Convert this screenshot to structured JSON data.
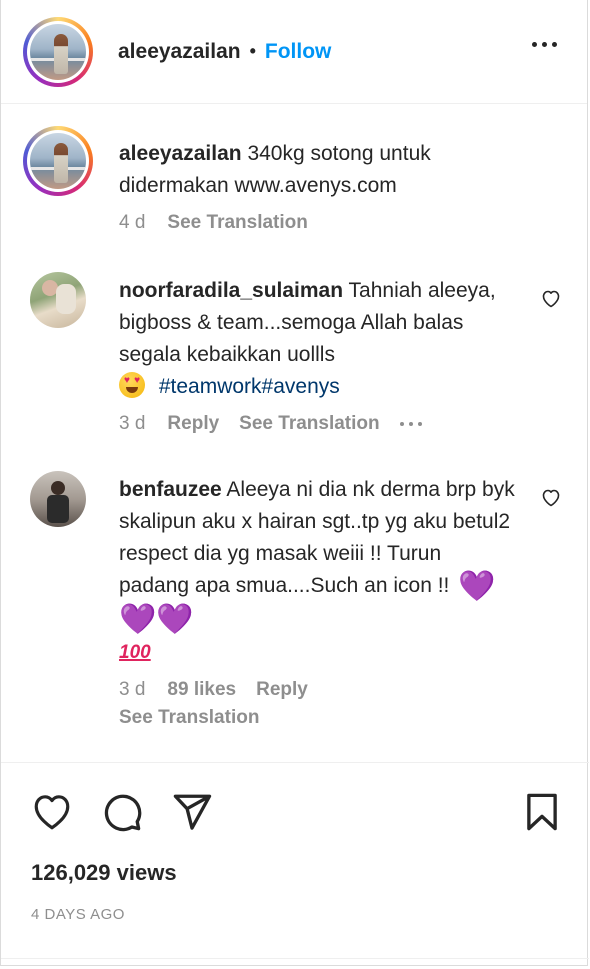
{
  "header": {
    "username": "aleeyazailan",
    "separator": "•",
    "follow_label": "Follow",
    "more_icon": "more-horizontal-icon"
  },
  "caption": {
    "username": "aleeyazailan",
    "text": "340kg sotong untuk didermakan www.avenys.com",
    "time": "4 d",
    "see_translation": "See Translation"
  },
  "comments": [
    {
      "username": "noorfaradila_sulaiman",
      "text": "Tahniah aleeya, bigboss & team...semoga Allah balas segala kebaikkan uollls",
      "emoji": "heart-eyes-emoji",
      "hashtags": "#teamwork#avenys",
      "time": "3 d",
      "reply": "Reply",
      "see_translation": "See Translation"
    },
    {
      "username": "benfauzee",
      "text": "Aleeya ni dia nk derma brp byk skalipun aku x hairan sgt..tp yg aku betul2 respect dia yg masak weiii !! Turun padang apa smua....Such an icon !!",
      "hearts": "💜💜💜",
      "hundred": "100",
      "time": "3 d",
      "likes": "89 likes",
      "reply": "Reply",
      "see_translation": "See Translation"
    }
  ],
  "actions": {
    "like_icon": "heart-icon",
    "comment_icon": "comment-icon",
    "share_icon": "send-icon",
    "save_icon": "bookmark-icon"
  },
  "stats": {
    "views": "126,029 views",
    "time_ago": "4 DAYS AGO"
  },
  "colors": {
    "link_blue": "#0095f6",
    "hashtag": "#00376b",
    "muted": "#8e8e8e",
    "text": "#262626"
  }
}
